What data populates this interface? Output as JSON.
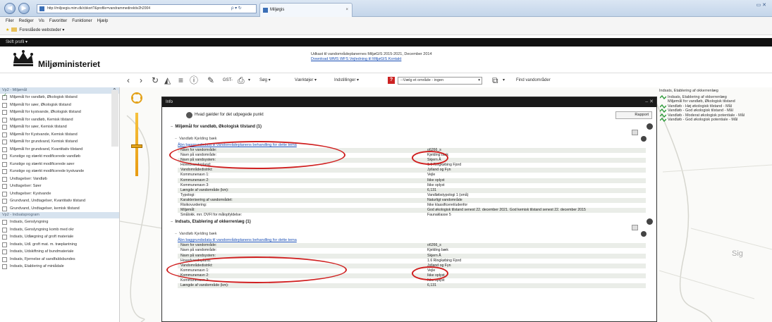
{
  "browser": {
    "url": "http://miljoegis.mim.dk/cbkort?&profile=vandrammedirektiv2h2004",
    "addr_controls": "ρ ▾ ↻",
    "tab_title": "Miljøgis",
    "menu": [
      "Filer",
      "Rediger",
      "Vis",
      "Favoritter",
      "Funktioner",
      "Hjælp"
    ],
    "favorites_label": "Foreslåede websteder ▾",
    "profile_label": "Skift profil ▾"
  },
  "header": {
    "ministry": "Miljøministeriet",
    "notice_line": "Udkast til vandområdeplanernes MiljøGIS 2015-2021, December 2014",
    "notice_link": "Download WMS WFS Vejledning til MiljøGIS Kontakt"
  },
  "toolbar": {
    "gst": "GST-",
    "search": "Søg ▾",
    "tools": "Værktøjer ▾",
    "settings": "Indstillinger ▾",
    "layer_select": "--Vælg et område - ingen",
    "find": "Find vandområder"
  },
  "sidebar": {
    "groups": [
      {
        "title": "Vp2 - Miljømål",
        "items": [
          {
            "label": "Miljømål for vandløb, Økologisk tilstand",
            "checked": true
          },
          {
            "label": "Miljømål for søer, Økologisk tilstand",
            "checked": false
          },
          {
            "label": "Miljømål for kystvande, Økologisk tilstand",
            "checked": false
          },
          {
            "label": "Miljømål for vandløb, Kemisk tilstand",
            "checked": false
          },
          {
            "label": "Miljømål for søer, Kemisk tilstand",
            "checked": false
          },
          {
            "label": "Miljømål for Kystvande, Kemisk tilstand",
            "checked": false
          },
          {
            "label": "Miljømål for grundvand, Kemisk tilstand",
            "checked": false
          },
          {
            "label": "Miljømål for grundvand, Kvantitativ tilstand",
            "checked": false
          },
          {
            "label": "Kunstige og stærkt modificerede vandløb",
            "checked": false
          },
          {
            "label": "Kunstige og stærkt modificerede søer",
            "checked": false
          },
          {
            "label": "Kunstige og stærkt modificerede kystvande",
            "checked": false
          },
          {
            "label": "Undtagelser: Vandløb",
            "checked": false
          },
          {
            "label": "Undtagelser: Søer",
            "checked": false
          },
          {
            "label": "Undtagelser: Kystvande",
            "checked": false
          },
          {
            "label": "Grundvand, Undtagelser, Kvantitativ tilstand",
            "checked": false
          },
          {
            "label": "Grundvand, Undtagelser, kemisk tilstand",
            "checked": false
          }
        ]
      },
      {
        "title": "Vp2 - Indsatsprogram",
        "items": [
          {
            "label": "Indsats, Genslyngning",
            "checked": false
          },
          {
            "label": "Indsats, Genslyngning komb med okr",
            "checked": false
          },
          {
            "label": "Indsats, Udlægning af groft materiale",
            "checked": false
          },
          {
            "label": "Indsats, Udl. groft mat. m. træplantning",
            "checked": false
          },
          {
            "label": "Indsats, Udskiftning af bundmateriale",
            "checked": false
          },
          {
            "label": "Indsats, Fjernelse af sandfaldsbundes",
            "checked": false
          },
          {
            "label": "Indsats, Etablering af miniådale",
            "checked": false
          }
        ]
      }
    ]
  },
  "legend": {
    "title": "Indsats, Etablering af okkerrenlæg",
    "rows": [
      {
        "label": "Indsats, Etablering af okkerrenlæg",
        "color": "#2e9b3a"
      },
      {
        "label": "Miljømål for vandløb, Økologisk tilstand",
        "color": ""
      },
      {
        "label": "Vandløb - Høj økologisk tilstand - Mål",
        "color": "#2e9b3a"
      },
      {
        "label": "Vandløb - God økologisk tilstand - Mål",
        "color": "#2e9b3a"
      },
      {
        "label": "Vandløb - Moderat økologisk potentiale - Mål",
        "color": "#2e9b3a"
      },
      {
        "label": "Vandløb - God økologisk potentiale - Mål",
        "color": "#2e9b3a"
      }
    ]
  },
  "map": {
    "place_label": "Sig"
  },
  "info": {
    "window_title": "Info",
    "subheader": "Hvad gælder for det udpegede punkt",
    "report_label": "Rapport",
    "sections": [
      {
        "title": "Miljømål for vandløb, Økologisk tilstand (1)",
        "subtitle": "Vandløb Kjelding bæk",
        "link": "Åbn baggrundsdata til vandområdeplanens behandling for dette tema",
        "rows": [
          {
            "k": "Navn for vandområde:",
            "v": "o6266_s"
          },
          {
            "k": "Navn på vandområde:",
            "v": "Kjelding bæk"
          },
          {
            "k": "Navn på vandsystem:",
            "v": "Skjern Å"
          },
          {
            "k": "Hovedvandopland:",
            "v": "1.6 Ringkøbing Fjord"
          },
          {
            "k": "Vandområdedistrikt:",
            "v": "Jylland og Fyn"
          },
          {
            "k": "Kommunenavn 1:",
            "v": "Vejle"
          },
          {
            "k": "Kommunenavn 2:",
            "v": "Ikke oplyst"
          },
          {
            "k": "Kommunenavn 3:",
            "v": "Ikke oplyst"
          },
          {
            "k": "Længde af vandområde (km):",
            "v": "6,131"
          },
          {
            "k": "Typologi:",
            "v": "Vandløbstypologi 1 (små)"
          },
          {
            "k": "Karakterisering af vandområdet:",
            "v": "Naturligt vandområde"
          },
          {
            "k": "Risikovurdering:",
            "v": "Ikke klassificeret/udenfor"
          },
          {
            "k": "Miljømål:",
            "v": "God økologisk tilstand senest 22. december 2021. God kemisk tilstand senest 22. december 2015"
          },
          {
            "k": "Smålokk. mrr. DVFI for målopfyldelse:",
            "v": "Faunaklasse 5"
          }
        ]
      },
      {
        "title": "Indsats, Etablering af okkerrenlæg (1)",
        "subtitle": "Vandløb Kjelding bæk",
        "link": "Åbn baggrundsdata til vandområdeplanens behandling for dette tema",
        "rows": [
          {
            "k": "Navn for vandområde:",
            "v": "o6266_s"
          },
          {
            "k": "Navn på vandområde:",
            "v": "Kjelding bæk"
          },
          {
            "k": "Navn på vandsystem:",
            "v": "Skjern Å"
          },
          {
            "k": "Hovedvandopland:",
            "v": "1.6 Ringkøbing Fjord"
          },
          {
            "k": "Vandområdedistrikt:",
            "v": "Jylland og Fyn"
          },
          {
            "k": "Kommunenavn 1:",
            "v": "Vejle"
          },
          {
            "k": "Kommunenavn 2:",
            "v": "Ikke oplyst"
          },
          {
            "k": "Kommunenavn 3:",
            "v": "Ikke oplyst"
          },
          {
            "k": "Længde af vandområde (km):",
            "v": "6,131"
          }
        ]
      }
    ]
  }
}
